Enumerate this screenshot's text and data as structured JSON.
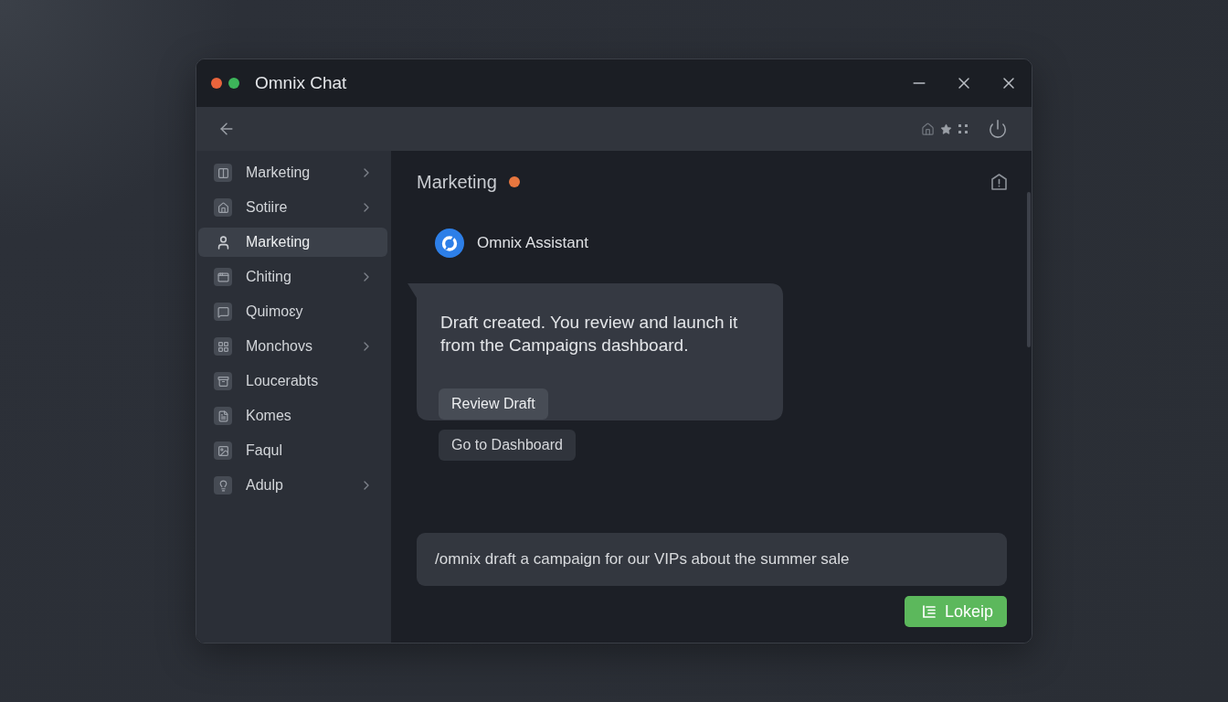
{
  "window": {
    "title": "Omnix Chat"
  },
  "sidebar": {
    "items": [
      {
        "label": "Marketing",
        "selected": false,
        "has_submenu": true
      },
      {
        "label": "Sotiire",
        "selected": false,
        "has_submenu": true
      },
      {
        "label": "Marketing",
        "selected": true,
        "has_submenu": false
      },
      {
        "label": "Chiting",
        "selected": false,
        "has_submenu": true
      },
      {
        "label": "Quimoɛy",
        "selected": false,
        "has_submenu": false
      },
      {
        "label": "Monchovs",
        "selected": false,
        "has_submenu": true
      },
      {
        "label": "Loucerabts",
        "selected": false,
        "has_submenu": false
      },
      {
        "label": "Komes",
        "selected": false,
        "has_submenu": false
      },
      {
        "label": "Faqul",
        "selected": false,
        "has_submenu": false
      },
      {
        "label": "Adulp",
        "selected": false,
        "has_submenu": true
      }
    ]
  },
  "channel": {
    "title": "Marketing",
    "status_dot": {
      "color": "#e8773f"
    }
  },
  "messages": [
    {
      "sender": "Omnix Assistant",
      "text": "Draft created. You review and launch it from the Campaigns dashboard.",
      "actions": [
        {
          "label": "Review Draft",
          "kind": "primary"
        },
        {
          "label": "Go to Dashboard",
          "kind": "secondary"
        }
      ]
    }
  ],
  "composer": {
    "value": "/omnix draft a campaign for our VIPs about the summer sale",
    "send_button": "Lokeip"
  }
}
